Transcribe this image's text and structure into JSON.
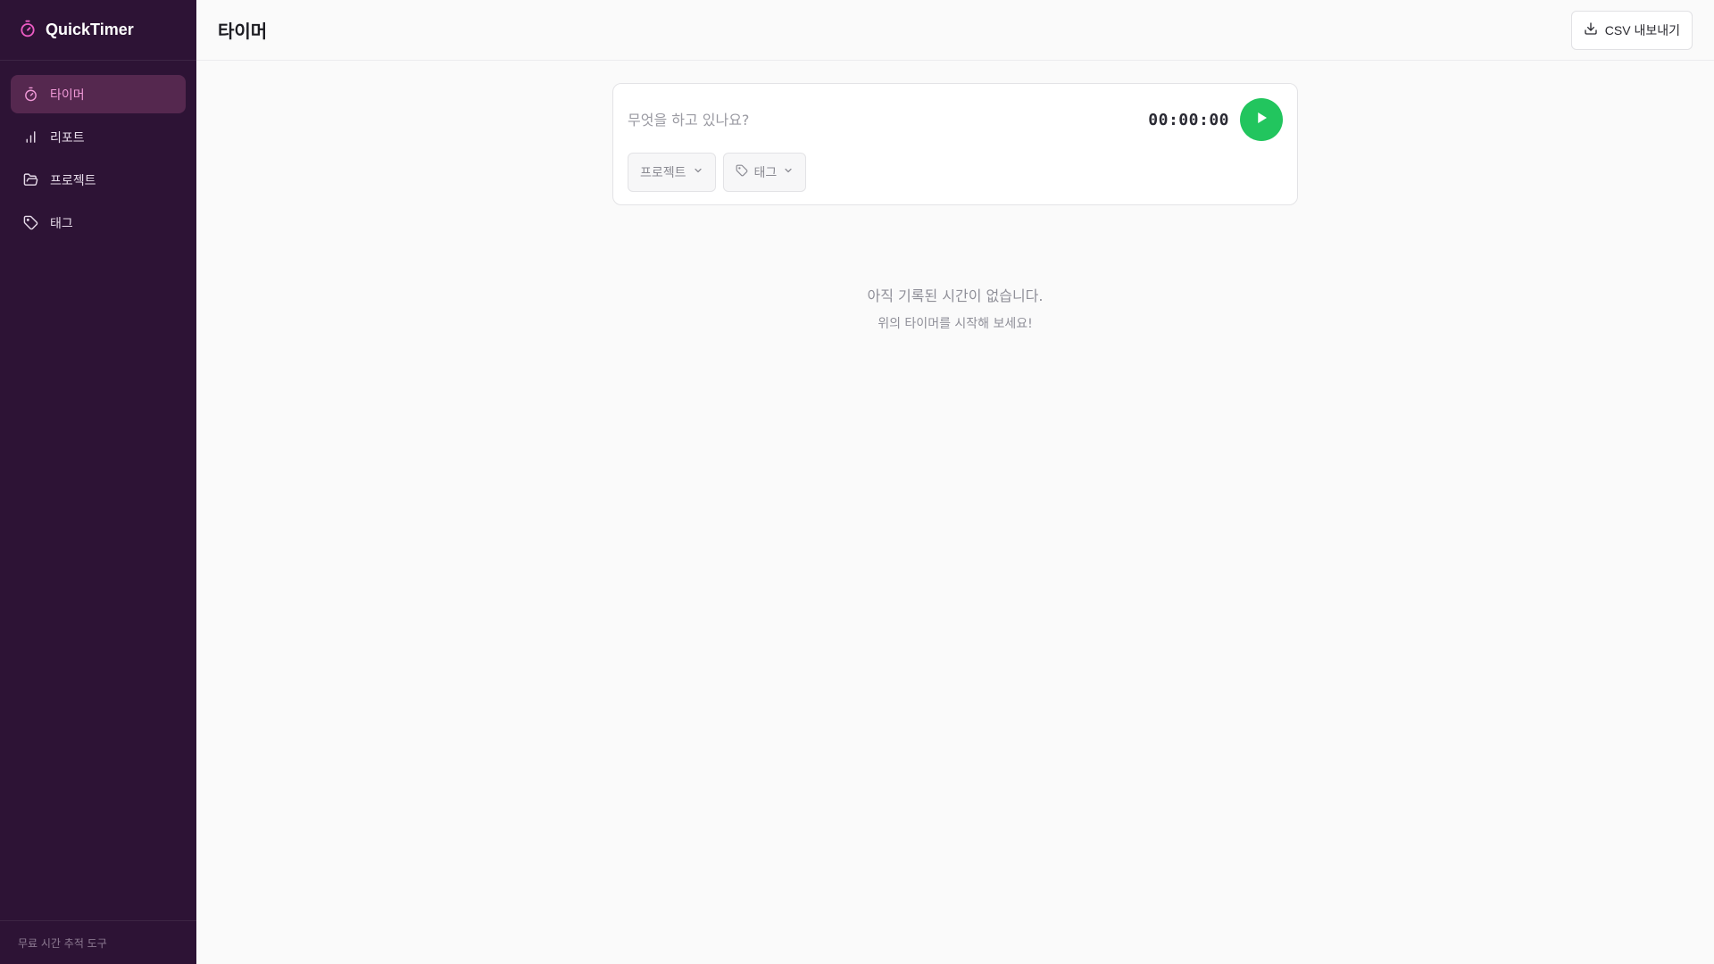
{
  "app": {
    "name": "QuickTimer"
  },
  "sidebar": {
    "items": [
      {
        "label": "타이머",
        "icon": "timer-icon",
        "active": true
      },
      {
        "label": "리포트",
        "icon": "bar-chart-icon",
        "active": false
      },
      {
        "label": "프로젝트",
        "icon": "folder-icon",
        "active": false
      },
      {
        "label": "태그",
        "icon": "tag-icon",
        "active": false
      }
    ],
    "footer": "무료 시간 추적 도구"
  },
  "header": {
    "title": "타이머",
    "export_label": "CSV 내보내기"
  },
  "timer": {
    "placeholder": "무엇을 하고 있나요?",
    "time": "00:00:00",
    "project_label": "프로젝트",
    "tag_label": "태그"
  },
  "empty_state": {
    "title": "아직 기록된 시간이 없습니다.",
    "subtitle": "위의 타이머를 시작해 보세요!"
  },
  "colors": {
    "sidebar_bg": "#2d1335",
    "active_item_bg": "#55284f",
    "active_text": "#f19ad8",
    "play_button": "#22c55e"
  }
}
